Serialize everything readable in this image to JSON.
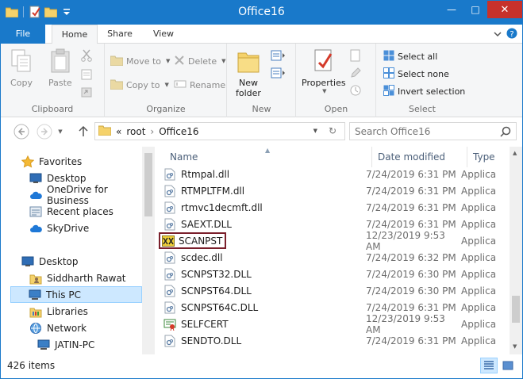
{
  "window": {
    "title": "Office16"
  },
  "tabs": [
    {
      "label": "File"
    },
    {
      "label": "Home"
    },
    {
      "label": "Share"
    },
    {
      "label": "View"
    }
  ],
  "ribbon": {
    "clipboard": {
      "label": "Clipboard",
      "copy": "Copy",
      "paste": "Paste"
    },
    "organize": {
      "label": "Organize",
      "move_to": "Move to",
      "copy_to": "Copy to",
      "delete": "Delete",
      "rename": "Rename"
    },
    "new": {
      "label": "New",
      "new_folder_line1": "New",
      "new_folder_line2": "folder"
    },
    "open": {
      "label": "Open",
      "properties": "Properties"
    },
    "select": {
      "label": "Select",
      "select_all": "Select all",
      "select_none": "Select none",
      "invert_selection": "Invert selection"
    }
  },
  "address": {
    "overflow": "«",
    "crumbs": [
      "root",
      "Office16"
    ],
    "search_placeholder": "Search Office16"
  },
  "nav": [
    {
      "label": "Favorites",
      "icon": "star-icon",
      "selected": false
    },
    {
      "label": "Desktop",
      "icon": "desktop-icon",
      "selected": false
    },
    {
      "label": "OneDrive for Business",
      "icon": "cloud-icon",
      "selected": false
    },
    {
      "label": "Recent places",
      "icon": "recent-places-icon",
      "selected": false
    },
    {
      "label": "SkyDrive",
      "icon": "cloud-icon",
      "selected": false
    },
    {
      "label": "Desktop",
      "icon": "desktop-icon",
      "selected": false
    },
    {
      "label": "Siddharth Rawat",
      "icon": "user-folder-icon",
      "selected": false
    },
    {
      "label": "This PC",
      "icon": "computer-icon",
      "selected": true
    },
    {
      "label": "Libraries",
      "icon": "libraries-icon",
      "selected": false
    },
    {
      "label": "Network",
      "icon": "network-icon",
      "selected": false
    },
    {
      "label": "JATIN-PC",
      "icon": "computer-icon",
      "selected": false
    }
  ],
  "columns": {
    "name": "Name",
    "date": "Date modified",
    "type": "Type"
  },
  "files": [
    {
      "name": "Rtmpal.dll",
      "date": "7/24/2019 6:31 PM",
      "type": "Applica",
      "icon": "dll-icon"
    },
    {
      "name": "RTMPLTFM.dll",
      "date": "7/24/2019 6:31 PM",
      "type": "Applica",
      "icon": "dll-icon"
    },
    {
      "name": "rtmvc1decmft.dll",
      "date": "7/24/2019 6:31 PM",
      "type": "Applica",
      "icon": "dll-icon"
    },
    {
      "name": "SAEXT.DLL",
      "date": "7/24/2019 6:31 PM",
      "type": "Applica",
      "icon": "dll-icon"
    },
    {
      "name": "SCANPST",
      "date": "12/23/2019 9:53 AM",
      "type": "Applica",
      "icon": "scanpst-icon"
    },
    {
      "name": "scdec.dll",
      "date": "7/24/2019 6:32 PM",
      "type": "Applica",
      "icon": "dll-icon"
    },
    {
      "name": "SCNPST32.DLL",
      "date": "7/24/2019 6:30 PM",
      "type": "Applica",
      "icon": "dll-icon"
    },
    {
      "name": "SCNPST64.DLL",
      "date": "7/24/2019 6:30 PM",
      "type": "Applica",
      "icon": "dll-icon"
    },
    {
      "name": "SCNPST64C.DLL",
      "date": "7/24/2019 6:31 PM",
      "type": "Applica",
      "icon": "dll-icon"
    },
    {
      "name": "SELFCERT",
      "date": "12/23/2019 9:53 AM",
      "type": "Applica",
      "icon": "certificate-icon"
    },
    {
      "name": "SENDTO.DLL",
      "date": "7/24/2019 6:31 PM",
      "type": "Applica",
      "icon": "dll-icon"
    }
  ],
  "status": {
    "item_count": "426 items"
  },
  "colors": {
    "accent": "#1979ca",
    "close": "#c7312b",
    "selection": "#cde8ff",
    "highlight_box": "#7a1f2b"
  }
}
